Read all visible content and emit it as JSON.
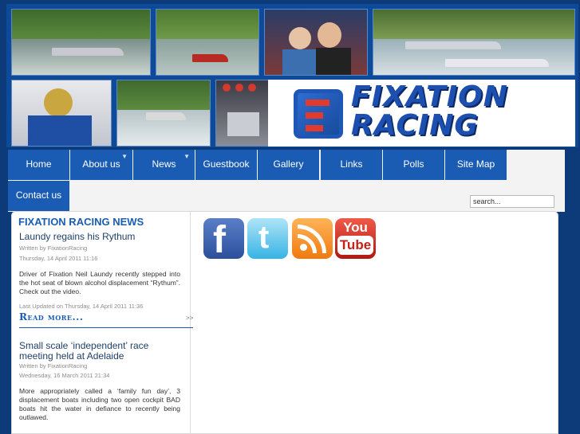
{
  "banner": {
    "logo_line1": "FIXATION",
    "logo_line2": "RACING"
  },
  "nav": {
    "items": [
      {
        "label": "Home",
        "has_dropdown": false
      },
      {
        "label": "About us",
        "has_dropdown": true
      },
      {
        "label": "News",
        "has_dropdown": true
      },
      {
        "label": "Guestbook",
        "has_dropdown": false
      },
      {
        "label": "Gallery",
        "has_dropdown": false
      },
      {
        "label": "Links",
        "has_dropdown": false
      },
      {
        "label": "Polls",
        "has_dropdown": false
      },
      {
        "label": "Site Map",
        "has_dropdown": false
      },
      {
        "label": "Contact us",
        "has_dropdown": false
      }
    ]
  },
  "search": {
    "value": "search..."
  },
  "news": {
    "section_title": "FIXATION RACING NEWS",
    "articles": [
      {
        "title": "Laundy regains his Rythum",
        "author": "Written by FixationRacing",
        "date": "Thursday, 14 April 2011 11:16",
        "body": "Driver of Fixation Neil Laundy recently stepped into the hot seat of blown alcohol displacement “Rythum”. Check out the video.",
        "updated": "Last Updated on Thursday, 14 April 2011 11:36",
        "read_more": "Read more...",
        "read_more_arrow": ">>"
      },
      {
        "title": "Small scale ‘independent’ race meeting held at Adelaide",
        "author": "Written by FixationRacing",
        "date": "Wednesday, 16 March 2011 21:34",
        "body": "More appropriately called a ‘family fun day’, 3 displacement boats including two open cockpit BAD boats hit the water in defiance to recently being outlawed."
      }
    ]
  },
  "social": {
    "facebook_glyph": "f",
    "twitter_glyph": "t",
    "youtube_line1": "You",
    "youtube_line2": "Tube"
  },
  "colors": {
    "brand_blue": "#1a5cb3",
    "background": "#0d3a78"
  }
}
